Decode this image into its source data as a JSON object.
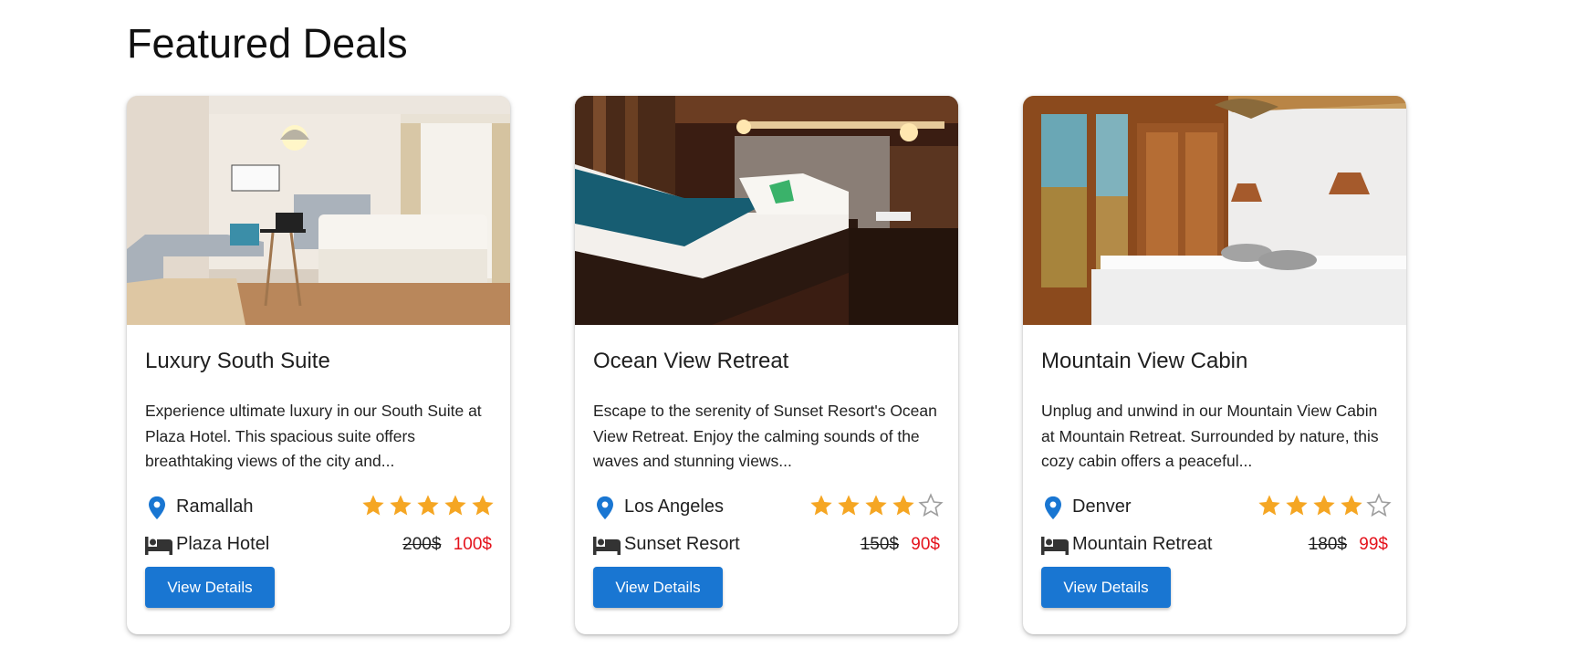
{
  "page": {
    "title": "Featured Deals"
  },
  "colors": {
    "primary": "#1976d2",
    "star": "#f5a623",
    "star_empty": "#9e9e9e",
    "sale_price": "#e4121b",
    "pin": "#1976d2"
  },
  "cards": [
    {
      "title": "Luxury South Suite",
      "description": "Experience ultimate luxury in our South Suite at Plaza Hotel. This spacious suite offers breathtaking views of the city and...",
      "location": "Ramallah",
      "hotel": "Plaza Hotel",
      "rating": 5,
      "old_price": "200$",
      "new_price": "100$",
      "button_label": "View Details",
      "image_alt": "bright hotel suite with bed and sofa"
    },
    {
      "title": "Ocean View Retreat",
      "description": "Escape to the serenity of Sunset Resort's Ocean View Retreat. Enjoy the calming sounds of the waves and stunning views...",
      "location": "Los Angeles",
      "hotel": "Sunset Resort",
      "rating": 4,
      "old_price": "150$",
      "new_price": "90$",
      "button_label": "View Details",
      "image_alt": "dark wood hotel room with bed and lamps"
    },
    {
      "title": "Mountain View Cabin",
      "description": "Unplug and unwind in our Mountain View Cabin at Mountain Retreat. Surrounded by nature, this cozy cabin offers a peaceful...",
      "location": "Denver",
      "hotel": "Mountain Retreat",
      "rating": 4,
      "old_price": "180$",
      "new_price": "99$",
      "button_label": "View Details",
      "image_alt": "cabin bedroom with wooden doors and wall lamps"
    }
  ],
  "icons": {
    "location": "location-pin-icon",
    "hotel": "bed-icon",
    "star_full": "star-filled-icon",
    "star_empty": "star-outline-icon"
  }
}
